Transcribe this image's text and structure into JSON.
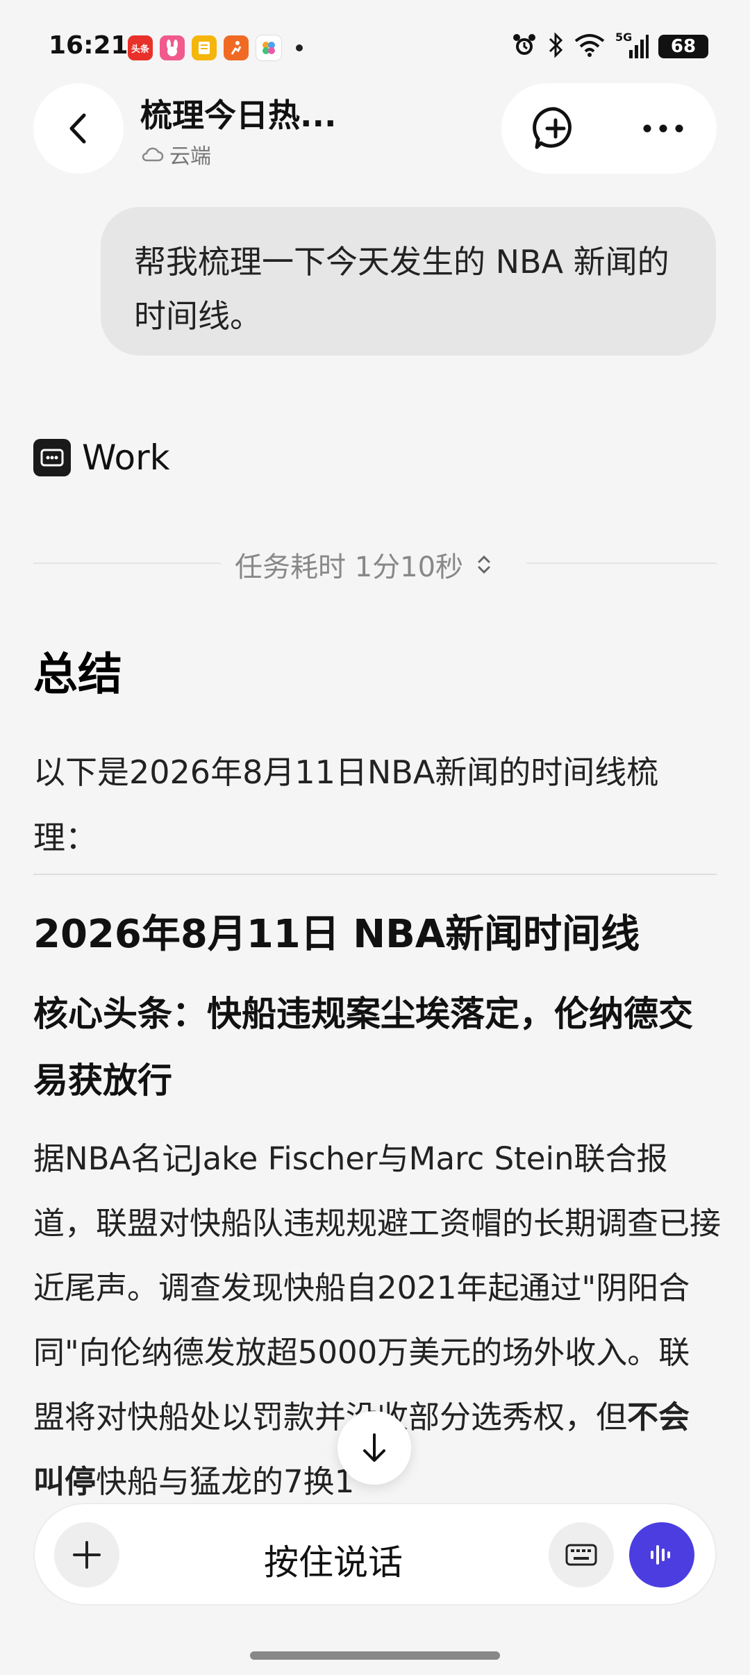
{
  "status_bar": {
    "time": "16:21",
    "apps": [
      {
        "name": "toutiao-app-icon",
        "label": "头条",
        "color": "#e8312a"
      },
      {
        "name": "rabbit-app-icon",
        "label": "",
        "color": "#f15a8c"
      },
      {
        "name": "notes-app-icon",
        "label": "",
        "color": "#f5b50a"
      },
      {
        "name": "running-app-icon",
        "label": "",
        "color": "#f06a24"
      },
      {
        "name": "flower-app-icon",
        "label": "",
        "color": "#ffffff"
      }
    ],
    "signal_label": "5G",
    "battery": "68"
  },
  "header": {
    "title": "梳理今日热...",
    "subtitle": "云端"
  },
  "user_message": "帮我梳理一下今天发生的 NBA 新闻的时间线。",
  "work": {
    "label": "Work",
    "duration": "任务耗时 1分10秒"
  },
  "content": {
    "summary_heading": "总结",
    "intro": "以下是2026年8月11日NBA新闻的时间线梳理：",
    "timeline_heading": "2026年8月11日 NBA新闻时间线",
    "core_heading": "核心头条：快船违规案尘埃落定，伦纳德交易获放行",
    "article_before_bold": "据NBA名记Jake Fischer与Marc Stein联合报道，联盟对快船队违规规避工资帽的长期调查已接近尾声。调查发现快船自2021年起通过\"阴阳合同\"向伦纳德发放超5000万美元的场外收入。联盟将对快船处以罚款并没收部分选秀权，但",
    "article_bold": "不会叫停",
    "article_after_bold": "快船与猛龙的7换1"
  },
  "input_bar": {
    "placeholder": "按住说话"
  },
  "colors": {
    "accent": "#4b3de0",
    "background": "#f5f5f5",
    "bubble": "#e6e6e6"
  }
}
